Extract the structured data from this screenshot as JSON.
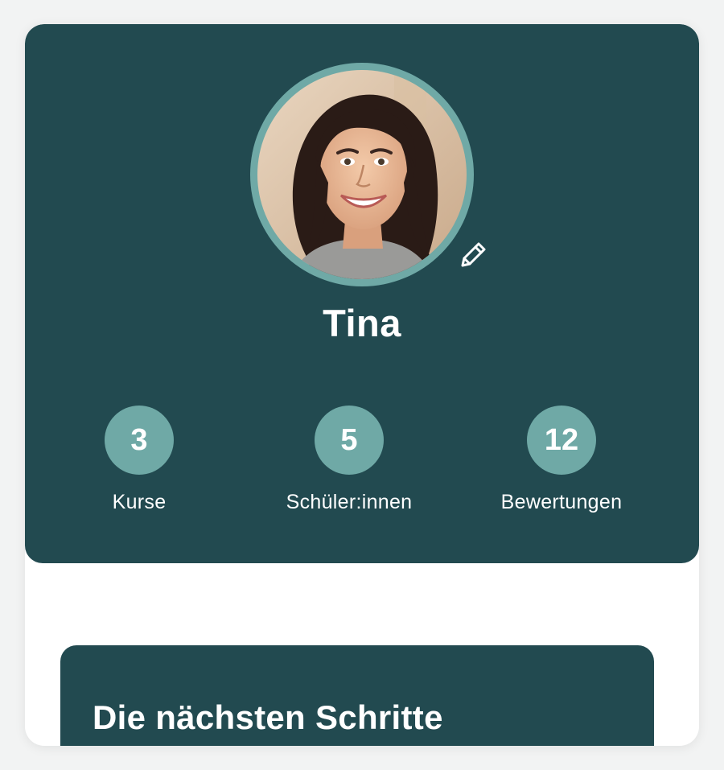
{
  "profile": {
    "name": "Tina",
    "avatar_alt": "avatar"
  },
  "stats": [
    {
      "value": "3",
      "label": "Kurse"
    },
    {
      "value": "5",
      "label": "Schüler:innen"
    },
    {
      "value": "12",
      "label": "Bewertungen"
    }
  ],
  "next_steps": {
    "title": "Die nächsten Schritte"
  },
  "colors": {
    "primary": "#224a50",
    "accent": "#6fa9a6",
    "card": "#ffffff",
    "background": "#f2f3f3"
  },
  "icons": {
    "edit": "pencil-icon"
  }
}
